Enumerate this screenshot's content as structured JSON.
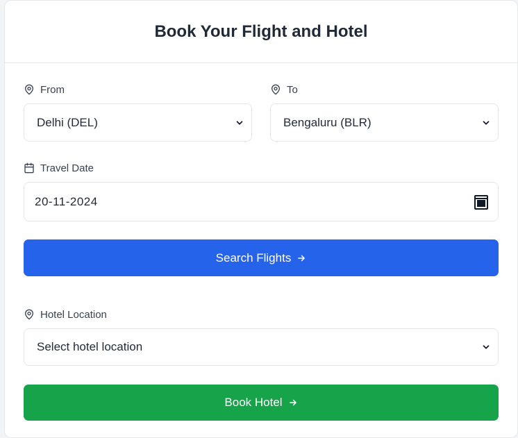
{
  "title": "Book Your Flight and Hotel",
  "flight": {
    "from_label": "From",
    "from_value": "Delhi (DEL)",
    "to_label": "To",
    "to_value": "Bengaluru (BLR)",
    "date_label": "Travel Date",
    "date_value": "20-11-2024",
    "search_button": "Search Flights"
  },
  "hotel": {
    "location_label": "Hotel Location",
    "location_placeholder": "Select hotel location",
    "book_button": "Book Hotel"
  },
  "colors": {
    "primary": "#2563eb",
    "success": "#16a34a"
  },
  "icons": [
    "map-pin-icon",
    "calendar-icon",
    "chevron-down-icon",
    "arrow-right-icon"
  ]
}
